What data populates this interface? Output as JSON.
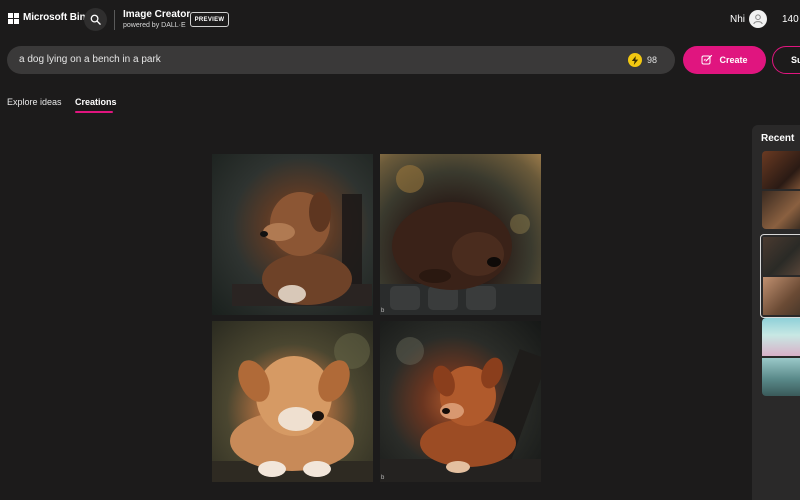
{
  "header": {
    "brand": "Microsoft Bing",
    "title": "Image Creator",
    "subtitle": "powered by DALL·E",
    "badge": "PREVIEW",
    "user_name": "Nhi",
    "reward_count": "140"
  },
  "search": {
    "prompt": "a dog lying on a bench in a park",
    "boosts": "98",
    "create_label": "Create",
    "surprise_label": "Su"
  },
  "tabs": [
    {
      "label": "Explore ideas",
      "active": false
    },
    {
      "label": "Creations",
      "active": true
    }
  ],
  "results": [
    {
      "subject": "dog"
    },
    {
      "subject": "dog"
    },
    {
      "subject": "dog"
    },
    {
      "subject": "dog"
    }
  ],
  "recent": {
    "title": "Recent"
  },
  "colors": {
    "background": "#1c1b1b",
    "accent": "#e0157f",
    "input_bg": "#3a3939",
    "boost": "#f2c811"
  },
  "icons": {
    "search": "search-icon",
    "boost": "bolt-icon",
    "create": "create-icon",
    "avatar": "user-icon"
  }
}
